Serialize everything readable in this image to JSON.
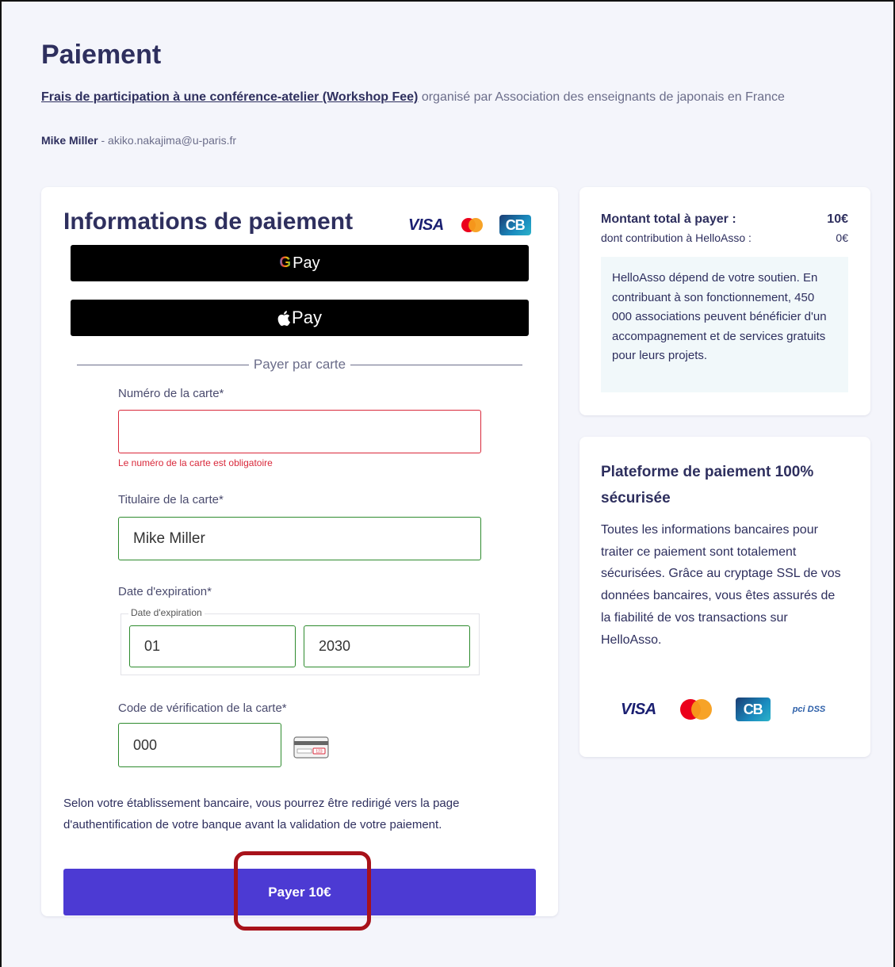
{
  "page": {
    "title": "Paiement",
    "event_link": "Frais de participation à une conférence-atelier (Workshop Fee)",
    "organizer_text": " organisé par Association des enseignants de japonais en France",
    "buyer_name": "Mike Miller",
    "buyer_email": " - akiko.nakajima@u-paris.fr"
  },
  "payment": {
    "title": "Informations de paiement",
    "brands": {
      "visa": "VISA",
      "cb": "CB"
    },
    "gpay_label": "Pay",
    "gpay_g": "G",
    "applepay_label": "Pay",
    "divider_text": "Payer par carte",
    "card_number": {
      "label": "Numéro de la carte*",
      "value": "",
      "error": "Le numéro de la carte est obligatoire"
    },
    "card_holder": {
      "label": "Titulaire de la carte*",
      "value": "Mike Miller"
    },
    "expiry": {
      "label": "Date d'expiration*",
      "legend": "Date d'expiration",
      "month": "01",
      "year": "2030"
    },
    "cvv": {
      "label": "Code de vérification de la carte*",
      "value": "000",
      "icon_text": "123"
    },
    "notice": "Selon votre établissement bancaire, vous pourrez être redirigé vers la page d'authentification de votre banque avant la validation de votre paiement.",
    "pay_button": "Payer 10€"
  },
  "summary": {
    "total_label": "Montant total à payer :",
    "total_value": "10€",
    "contribution_label": "dont contribution à HelloAsso :",
    "contribution_value": "0€",
    "support_text": "HelloAsso dépend de votre soutien. En contribuant à son fonctionnement, 450 000 associations peuvent bénéficier d'un accompagnement et de services gratuits pour leurs projets."
  },
  "security": {
    "title": "Plateforme de paiement 100% sécurisée",
    "text": "Toutes les informations bancaires pour traiter ce paiement sont totalement sécurisées. Grâce au cryptage SSL de vos données bancaires, vous êtes assurés de la fiabilité de vos transactions sur HelloAsso.",
    "logos": {
      "visa": "VISA",
      "cb": "CB",
      "pci": "pci DSS"
    }
  },
  "colors": {
    "accent": "#4c3ad3",
    "error": "#d9283a",
    "valid": "#2e8b2e",
    "text": "#2e2f5e",
    "highlight": "#a8121a"
  }
}
